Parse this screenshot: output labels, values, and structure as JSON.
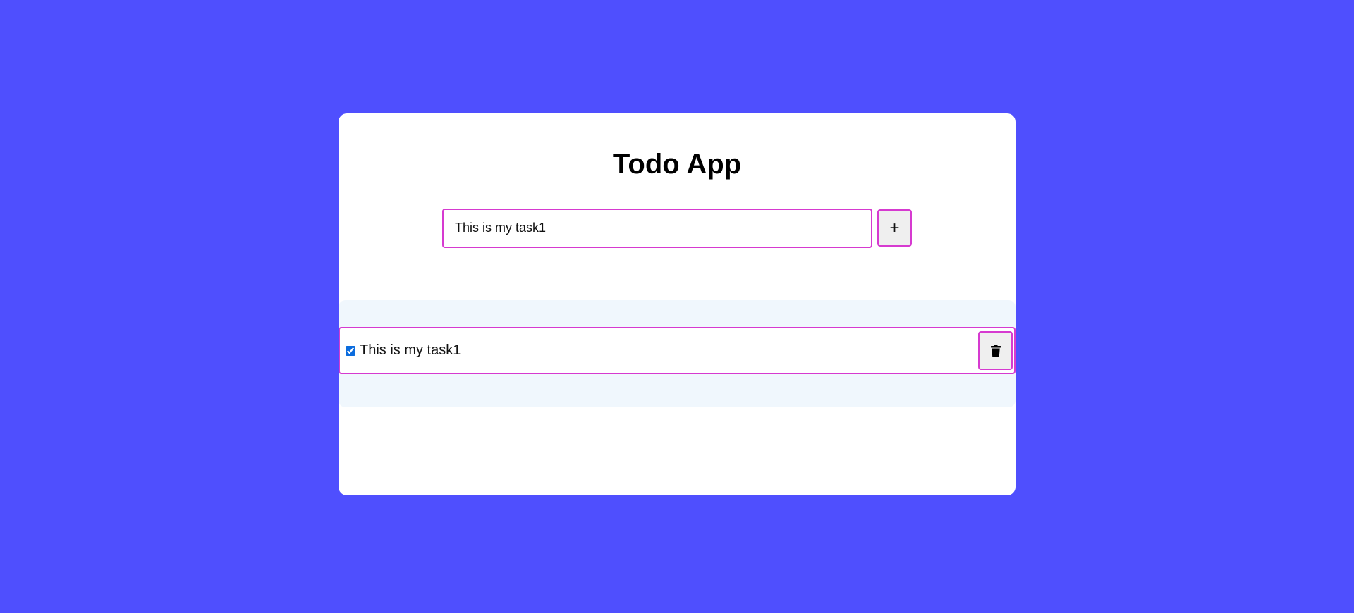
{
  "app": {
    "title": "Todo App"
  },
  "new_task": {
    "value": "This is my task1",
    "add_label": "+"
  },
  "tasks": [
    {
      "text": "This is my task1",
      "completed": true,
      "delete_icon": "trash-icon"
    }
  ],
  "colors": {
    "background": "#4f4ffe",
    "card": "#ffffff",
    "border_accent": "#d63ad0",
    "list_background": "#f0f7fd",
    "button_background": "#efefef",
    "checkbox": "#0b6cde"
  }
}
